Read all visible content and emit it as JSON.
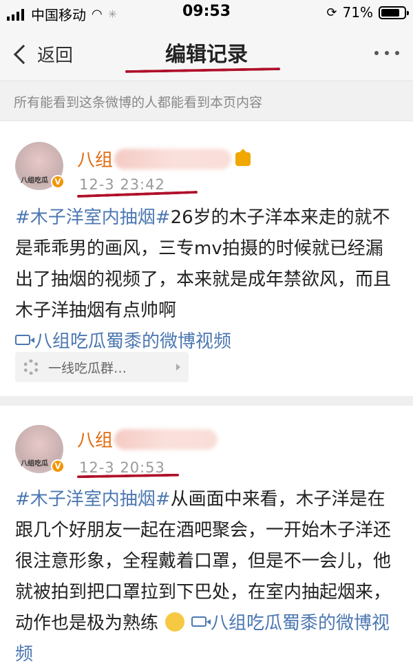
{
  "status_bar": {
    "carrier": "中国移动",
    "time": "09:53",
    "battery_pct": "71%",
    "battery_level": 0.71
  },
  "nav": {
    "back_label": "返回",
    "title": "编辑记录"
  },
  "notice": "所有能看到这条微博的人都能看到本页内容",
  "posts": [
    {
      "username_visible": "八组",
      "avatar_text": "八组吃瓜",
      "time": "12-3 23:42",
      "hashtag": "#木子洋室内抽烟#",
      "text": "26岁的木子洋本来走的就不是乖乖男的画风，三专mv拍摄的时候就已经漏出了抽烟的视频了，本来就是成年禁欲风，而且木子洋抽烟有点帅啊",
      "video_link": "八组吃瓜蜀黍的微博视频",
      "group_card": "一线吃瓜群…"
    },
    {
      "username_visible": "八组",
      "avatar_text": "八组吃瓜",
      "time": "12-3 20:53",
      "hashtag": "#木子洋室内抽烟#",
      "text": "从画面中来看，木子洋是在跟几个好朋友一起在酒吧聚会，一开始木子洋还很注意形象，全程戴着口罩，但是不一会儿，他就被拍到把口罩拉到下巴处，在室内抽起烟来，动作也是极为熟练",
      "video_link": "八组吃瓜蜀黍的微博视频"
    }
  ],
  "colors": {
    "link": "#4b77b1",
    "username": "#e06b10",
    "annotation": "#b0102a"
  },
  "icons": {
    "back": "chevron-left-icon",
    "more": "more-dots-icon",
    "video": "video-camera-icon",
    "verified": "verified-badge-icon",
    "vip": "crown-icon",
    "emoji": "thinking-face-icon"
  }
}
